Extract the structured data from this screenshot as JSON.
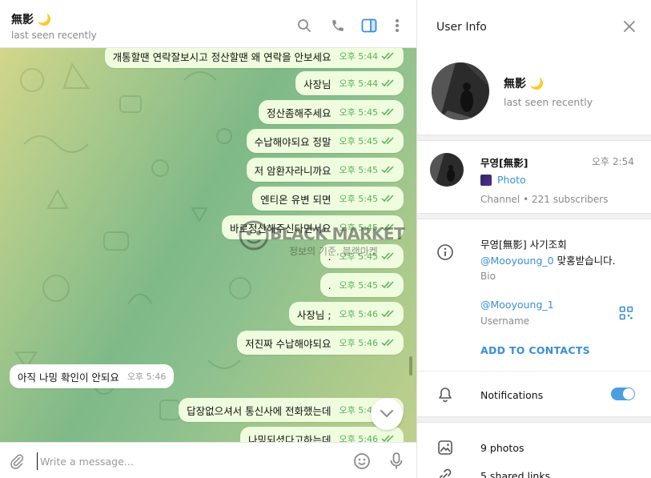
{
  "chat": {
    "title": "無影 🌙",
    "status": "last seen recently",
    "composer_placeholder": "Write a message..."
  },
  "messages": [
    {
      "text": "개통할땐 연락잘보시고 정산할땐 왜 연락을 안보세요",
      "time": "오후 5:44",
      "direction": "out"
    },
    {
      "text": "사장님",
      "time": "오후 5:44",
      "direction": "out"
    },
    {
      "text": "정산좀해주세요",
      "time": "오후 5:45",
      "direction": "out"
    },
    {
      "text": "수납해야되요 정말",
      "time": "오후 5:45",
      "direction": "out"
    },
    {
      "text": "저 암환자라니까요",
      "time": "오후 5:45",
      "direction": "out"
    },
    {
      "text": "엔티온 유변 되면",
      "time": "오후 5:45",
      "direction": "out"
    },
    {
      "text": "바로정산해주신다면서요",
      "time": "오후 5:45",
      "direction": "out"
    },
    {
      "text": ".",
      "time": "오후 5:45",
      "direction": "out"
    },
    {
      "text": ".",
      "time": "오후 5:45",
      "direction": "out"
    },
    {
      "text": "사장님 ;",
      "time": "오후 5:46",
      "direction": "out"
    },
    {
      "text": "저진짜 수납해야되요",
      "time": "오후 5:46",
      "direction": "out"
    },
    {
      "text": "아직 나밍 확인이 안되요",
      "time": "오후 5:46",
      "direction": "in"
    },
    {
      "text": "답장없으셔서 통신사에 전화했는데",
      "time": "오후 5:46",
      "direction": "out"
    },
    {
      "text": "나밍되셨다고하는데",
      "time": "오후 5:46",
      "direction": "out"
    }
  ],
  "watermark": {
    "title": "BLACK MARKET",
    "subtitle": "정보의 기준, 블랙마켓"
  },
  "info": {
    "panel_title": "User Info",
    "name": "無影 🌙",
    "status": "last seen recently",
    "channel": {
      "name": "무영[無影]",
      "time": "오후 2:54",
      "last_message": "Photo",
      "meta": "Channel • 221 subscribers"
    },
    "bio": {
      "line1": "무영[無影] 사기조회",
      "mention": "@Mooyoung_0",
      "line2_rest": " 맞홍받습니다.",
      "label": "Bio"
    },
    "username": {
      "value": "@Mooyoung_1",
      "label": "Username"
    },
    "add_contact": "ADD TO CONTACTS",
    "notifications": {
      "label": "Notifications",
      "enabled": true
    },
    "media": {
      "photos": "9 photos",
      "links": "5 shared links"
    }
  },
  "colors": {
    "accent": "#3a8fd6",
    "outgoing_bubble": "#effdde",
    "check": "#5aaf5a"
  }
}
